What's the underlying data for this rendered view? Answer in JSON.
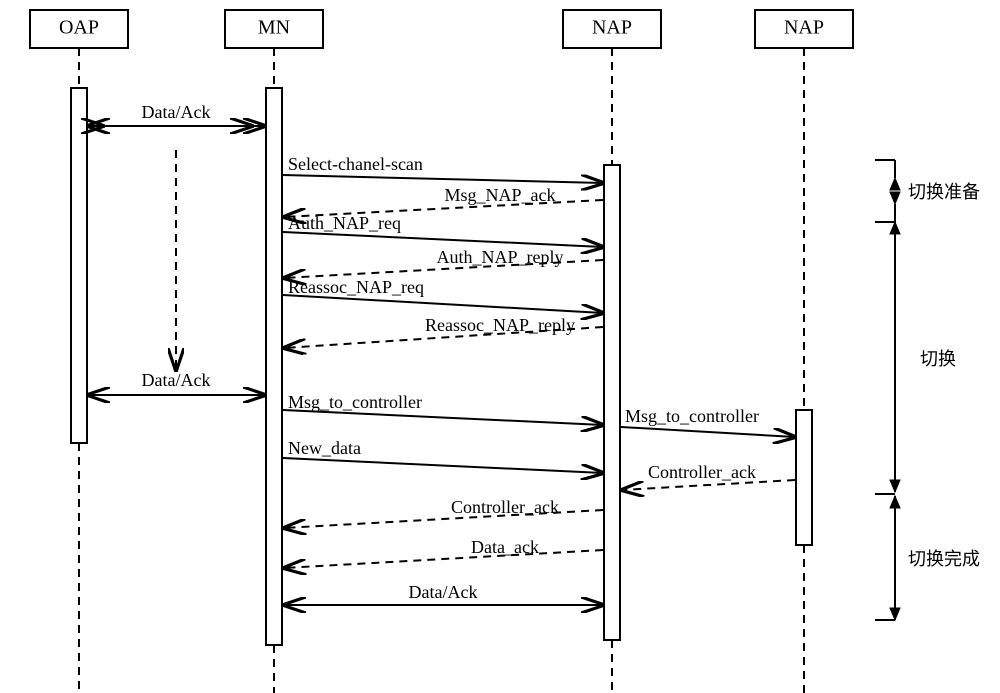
{
  "lifelines": {
    "oap": "OAP",
    "mn": "MN",
    "nap1": "NAP",
    "nap2": "NAP"
  },
  "messages": {
    "data_ack1": "Data/Ack",
    "select_scan": "Select-chanel-scan",
    "msg_nap_ack": "Msg_NAP_ack",
    "auth_req": "Auth_NAP_req",
    "auth_reply": "Auth_NAP_reply",
    "reassoc_req": "Reassoc_NAP_req",
    "reassoc_reply": "Reassoc_NAP_reply",
    "data_ack2": "Data/Ack",
    "msg_to_ctrl1": "Msg_to_controller",
    "msg_to_ctrl2": "Msg_to_controller",
    "new_data": "New_data",
    "ctrl_ack1": "Controller_ack",
    "ctrl_ack2": "Controller_ack",
    "data_ack_dash": "Data_ack",
    "data_ack3": "Data/Ack"
  },
  "phases": {
    "prepare": "切换准备",
    "handover": "切换",
    "complete": "切换完成"
  }
}
